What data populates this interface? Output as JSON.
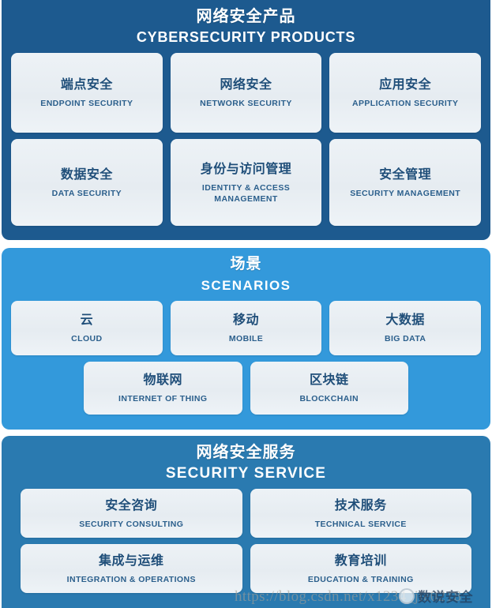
{
  "panels": [
    {
      "id": "cybersecurity-products",
      "title_cn": "网络安全产品",
      "title_en": "CYBERSECURITY PRODUCTS",
      "bg_color": "#1d5a8f",
      "rows": [
        [
          {
            "cn": "端点安全",
            "en": "ENDPOINT SECURITY"
          },
          {
            "cn": "网络安全",
            "en": "NETWORK SECURITY"
          },
          {
            "cn": "应用安全",
            "en": "APPLICATION SECURITY"
          }
        ],
        [
          {
            "cn": "数据安全",
            "en": "DATA SECURITY"
          },
          {
            "cn": "身份与访问管理",
            "en": "IDENTITY & ACCESS\nMANAGEMENT"
          },
          {
            "cn": "安全管理",
            "en": "SECURITY MANAGEMENT"
          }
        ]
      ]
    },
    {
      "id": "scenarios",
      "title_cn": "场景",
      "title_en": "SCENARIOS",
      "bg_color": "#3399db",
      "rows": [
        [
          {
            "cn": "云",
            "en": "CLOUD"
          },
          {
            "cn": "移动",
            "en": "MOBILE"
          },
          {
            "cn": "大数据",
            "en": "BIG DATA"
          }
        ],
        [
          {
            "cn": "物联网",
            "en": "INTERNET OF THING"
          },
          {
            "cn": "区块链",
            "en": "BLOCKCHAIN"
          }
        ]
      ]
    },
    {
      "id": "security-service",
      "title_cn": "网络安全服务",
      "title_en": "SECURITY SERVICE",
      "bg_color": "#2a7ab0",
      "rows": [
        [
          {
            "cn": "安全咨询",
            "en": "SECURITY CONSULTING"
          },
          {
            "cn": "技术服务",
            "en": "TECHNICAL SERVICE"
          }
        ],
        [
          {
            "cn": "集成与运维",
            "en": "INTEGRATION & OPERATIONS"
          },
          {
            "cn": "教育培训",
            "en": "EDUCATION & TRAINING"
          }
        ]
      ]
    }
  ],
  "watermark": {
    "url": "https://blog.csdn.net/x1234_jie0218",
    "brand": "数说安全"
  },
  "colors": {
    "card_bg": "#e9eef3",
    "card_text": "#1f4e79",
    "panel_products": "#1d5a8f",
    "panel_scenarios": "#3399db",
    "panel_services": "#2a7ab0"
  }
}
